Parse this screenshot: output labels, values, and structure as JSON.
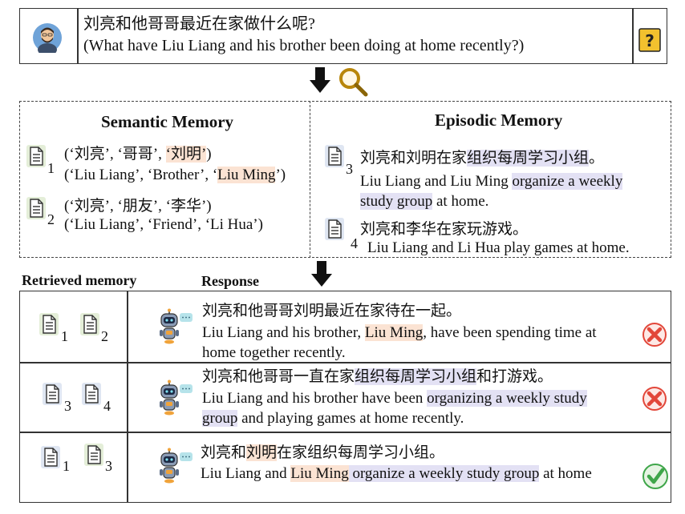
{
  "question": {
    "zh": "刘亮和他哥哥最近在家做什么呢?",
    "en": "(What have Liu Liang and his brother been doing at home recently?)",
    "icon": "question-mark-icon"
  },
  "semantic": {
    "title": "Semantic Memory",
    "items": [
      {
        "index": "1",
        "zh_prefix": "(‘刘亮’, ‘哥哥’, ",
        "zh_hl": "‘刘明’",
        "zh_suffix": ")",
        "en_prefix": "(‘Liu Liang’, ‘Brother’, ‘",
        "en_hl": "Liu Ming",
        "en_suffix": "’)"
      },
      {
        "index": "2",
        "zh": "(‘刘亮’, ‘朋友’, ‘李华’)",
        "en": "(‘Liu Liang’, ‘Friend’, ‘Li Hua’)"
      }
    ]
  },
  "episodic": {
    "title": "Episodic Memory",
    "items": [
      {
        "index": "3",
        "zh_prefix": "刘亮和刘明在家",
        "zh_hl": "组织每周学习小组",
        "zh_suffix": "。",
        "en_line1_prefix": "Liu Liang and Liu Ming ",
        "en_line1_hl": "organize a weekly",
        "en_line2_hl": "study group",
        "en_line2_suffix": " at home."
      },
      {
        "index": "4",
        "zh": "刘亮和李华在家玩游戏。",
        "en": "Liu Liang and Li Hua play games at home."
      }
    ]
  },
  "labels": {
    "retrieved": "Retrieved memory",
    "response": "Response"
  },
  "responses": [
    {
      "docs": [
        "1",
        "2"
      ],
      "zh": "刘亮和他哥哥刘明最近在家待在一起。",
      "en1_prefix": "Liu Liang and his brother, ",
      "en1_hl": "Liu Ming",
      "en1_suffix": ", have been spending time at",
      "en2": "home together recently.",
      "verdict": "wrong"
    },
    {
      "docs": [
        "3",
        "4"
      ],
      "zh_prefix": "刘亮和他哥哥一直在家",
      "zh_hl": "组织每周学习小组",
      "zh_suffix": "和打游戏。",
      "en1_prefix": "Liu Liang and his brother have been ",
      "en1_hl": "organizing a weekly study",
      "en2_hl": "group",
      "en2_suffix": " and playing games at home recently.",
      "verdict": "wrong"
    },
    {
      "docs": [
        "1",
        "3"
      ],
      "zh_prefix": "刘亮和",
      "zh_hl1": "刘明",
      "zh_mid": "在家组织每周学习小组。",
      "en_prefix": "Liu Liang and ",
      "en_hl1": "Liu Ming",
      "en_hl2": " organize a weekly study group",
      "en_suffix": " at home",
      "verdict": "correct"
    }
  ],
  "colors": {
    "highlight_orange": "#fbe3d3",
    "highlight_purple": "#e3e1f4",
    "doc_green": "#e4eed8",
    "doc_blue": "#dfe6f2",
    "wrong_red": "#e2473a",
    "correct_green": "#3fa64a",
    "question_yellow": "#f2c12e"
  }
}
